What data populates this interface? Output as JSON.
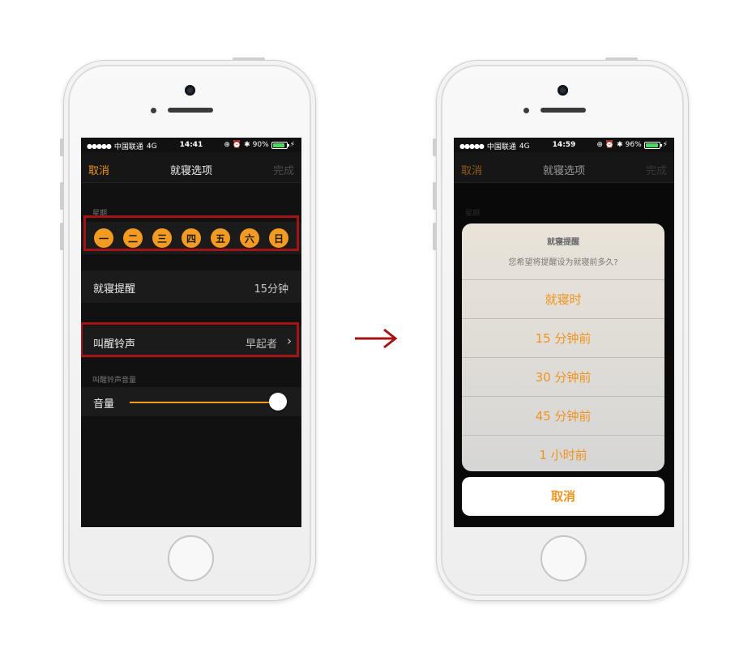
{
  "left_screen": {
    "status": {
      "carrier": "中国联通",
      "network": "4G",
      "time": "14:41",
      "battery": "90%",
      "battery_level": 0.9
    },
    "nav": {
      "cancel": "取消",
      "title": "就寝选项",
      "done": "完成"
    },
    "week_label": "星期",
    "days": [
      "一",
      "二",
      "三",
      "四",
      "五",
      "六",
      "日"
    ],
    "bedtime_reminder": {
      "label": "就寝提醒",
      "value": "15分钟"
    },
    "wake_sound": {
      "label": "叫醒铃声",
      "value": "早起者"
    },
    "volume_section_label": "叫醒铃声音量",
    "volume": {
      "label": "音量",
      "level": 1.0
    }
  },
  "right_screen": {
    "status": {
      "carrier": "中国联通",
      "network": "4G",
      "time": "14:59",
      "battery": "96%",
      "battery_level": 0.96
    },
    "nav": {
      "cancel": "取消",
      "title": "就寝选项",
      "done": "完成"
    },
    "week_label": "星期",
    "sheet": {
      "title": "就寝提醒",
      "message": "您希望将提醒设为就寝前多久?",
      "options": [
        "就寝时",
        "15 分钟前",
        "30 分钟前",
        "45 分钟前",
        "1 小时前"
      ],
      "cancel": "取消"
    }
  },
  "colors": {
    "accent": "#f29a22",
    "highlight": "#a51414",
    "arrow": "#a51414"
  }
}
